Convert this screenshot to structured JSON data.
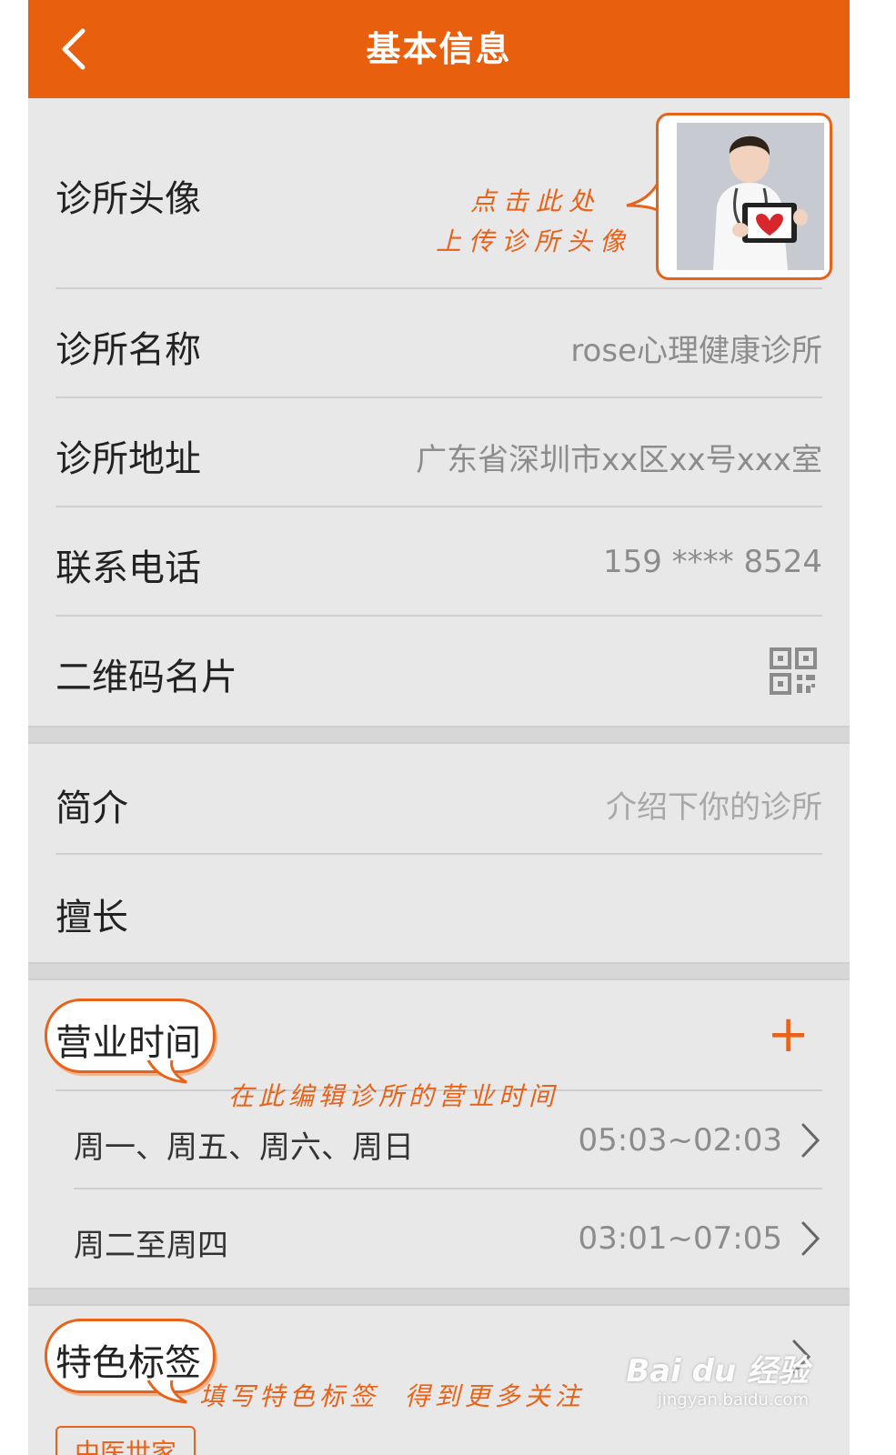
{
  "header": {
    "title": "基本信息"
  },
  "rows": {
    "avatar": {
      "label": "诊所头像",
      "hint_line1": "点击此处",
      "hint_line2": "上传诊所头像"
    },
    "name": {
      "label": "诊所名称",
      "value": "rose心理健康诊所"
    },
    "address": {
      "label": "诊所地址",
      "value": "广东省深圳市xx区xx号xxx室"
    },
    "phone": {
      "label": "联系电话",
      "value": "159 **** 8524"
    },
    "qrcode": {
      "label": "二维码名片",
      "icon": "qrcode-icon"
    },
    "intro": {
      "label": "简介",
      "placeholder": "介绍下你的诊所"
    },
    "specialty": {
      "label": "擅长"
    }
  },
  "hours": {
    "label": "营业时间",
    "add_symbol": "+",
    "hint": "在此编辑诊所的营业时间",
    "items": [
      {
        "days": "周一、周五、周六、周日",
        "time": "05:03~02:03"
      },
      {
        "days": "周二至周四",
        "time": "03:01~07:05"
      }
    ]
  },
  "tags": {
    "label": "特色标签",
    "hint": "填写特色标签  得到更多关注",
    "partial_tag": "中医世家"
  },
  "watermark": {
    "logo": "Bai du 经验",
    "url": "jingyan.baidu.com"
  },
  "colors": {
    "accent": "#e85f0d",
    "background": "#e8e8e8",
    "text": "#222222",
    "muted": "#8c8c8c"
  }
}
